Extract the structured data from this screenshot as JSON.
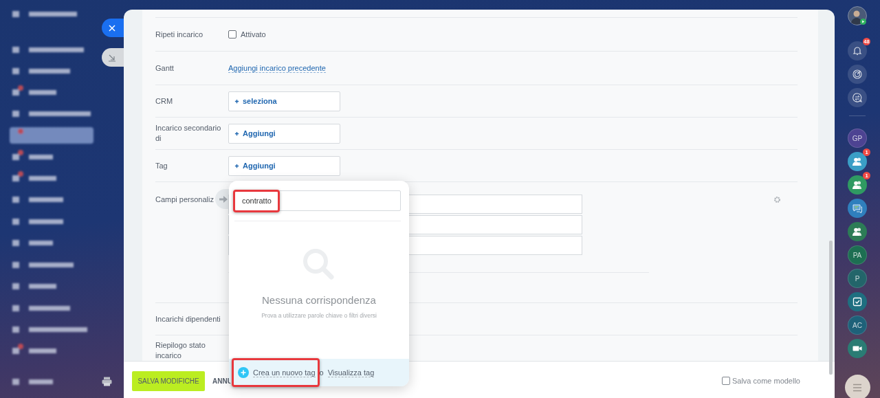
{
  "form": {
    "rows": [
      {
        "label": "Ripeti incarico",
        "kind": "checkbox",
        "option": {
          "label": "Attivato",
          "checked": false
        }
      },
      {
        "label": "Gantt",
        "kind": "link",
        "link": "Aggiungi incarico precedente"
      },
      {
        "label": "CRM",
        "kind": "selector",
        "action": "seleziona"
      },
      {
        "label": "Incarico secondario di",
        "kind": "selector",
        "action": "Aggiungi"
      },
      {
        "label": "Tag",
        "kind": "selector",
        "action": "Aggiungi"
      },
      {
        "label": "Campi personaliz",
        "kind": "custom_fields"
      },
      {
        "label": "Incarichi dipendenti",
        "kind": "empty"
      },
      {
        "label": "Riepilogo stato incarico",
        "kind": "empty"
      }
    ]
  },
  "tag_popup": {
    "search_value": "contratto",
    "search_highlighted": true,
    "empty_title": "Nessuna corrispondenza",
    "empty_hint": "Prova a utilizzare parole chiave o filtri diversi",
    "create_link": "Crea un nuovo tag",
    "create_highlighted": true,
    "separator": "o",
    "view_link": "Visualizza tag"
  },
  "footer": {
    "save_button": "SALVA MODIFICHE",
    "cancel_button": "ANNU",
    "template_option": {
      "label": "Salva come modello",
      "checked": false
    }
  },
  "right_bar": {
    "items": [
      {
        "kind": "avatar"
      },
      {
        "kind": "bell",
        "badge": "48"
      },
      {
        "kind": "radar"
      },
      {
        "kind": "chat_arrows"
      },
      {
        "kind": "divider"
      },
      {
        "kind": "initials",
        "text": "GP",
        "color": "#4d4392"
      },
      {
        "kind": "group",
        "badge": "1",
        "color": "#3a9ec6"
      },
      {
        "kind": "group",
        "badge": "1",
        "color": "#2f9a62"
      },
      {
        "kind": "chat",
        "color": "#2f7fbd"
      },
      {
        "kind": "group",
        "color": "#2c7c56"
      },
      {
        "kind": "initials",
        "text": "PA",
        "color": "#1d6e52"
      },
      {
        "kind": "initials",
        "text": "P",
        "color": "#23656a"
      },
      {
        "kind": "task",
        "color": "#1f6f80"
      },
      {
        "kind": "initials",
        "text": "AC",
        "color": "#1e6179"
      },
      {
        "kind": "video",
        "color": "#2a7c74"
      },
      {
        "kind": "menu"
      }
    ]
  }
}
